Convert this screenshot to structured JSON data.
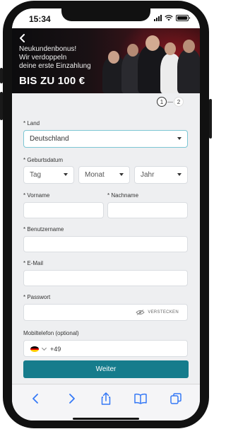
{
  "status_bar": {
    "time": "15:34"
  },
  "banner": {
    "line1": "Neukundenbonus!",
    "line2": "Wir verdoppeln",
    "line3": "deine erste Einzahlung",
    "headline": "BIS ZU 100 €",
    "back_icon": "chevron-left-icon"
  },
  "steps": {
    "current": "1",
    "next": "2"
  },
  "form": {
    "country": {
      "label": "* Land",
      "value": "Deutschland"
    },
    "birthdate": {
      "label": "* Geburtsdatum",
      "day": "Tag",
      "month": "Monat",
      "year": "Jahr"
    },
    "firstname": {
      "label": "* Vorname",
      "value": ""
    },
    "lastname": {
      "label": "* Nachname",
      "value": ""
    },
    "username": {
      "label": "* Benutzername",
      "value": ""
    },
    "email": {
      "label": "* E-Mail",
      "value": ""
    },
    "password": {
      "label": "* Passwort",
      "value": "",
      "toggle": "VERSTECKEN"
    },
    "phone": {
      "label": "Mobiltelefon (optional)",
      "prefix": "+49",
      "flag": "germany-flag-icon"
    },
    "submit": "Weiter"
  },
  "colors": {
    "accent": "#167c8c",
    "focus": "#7cc6d4",
    "safari_icons": "#3478f6"
  }
}
